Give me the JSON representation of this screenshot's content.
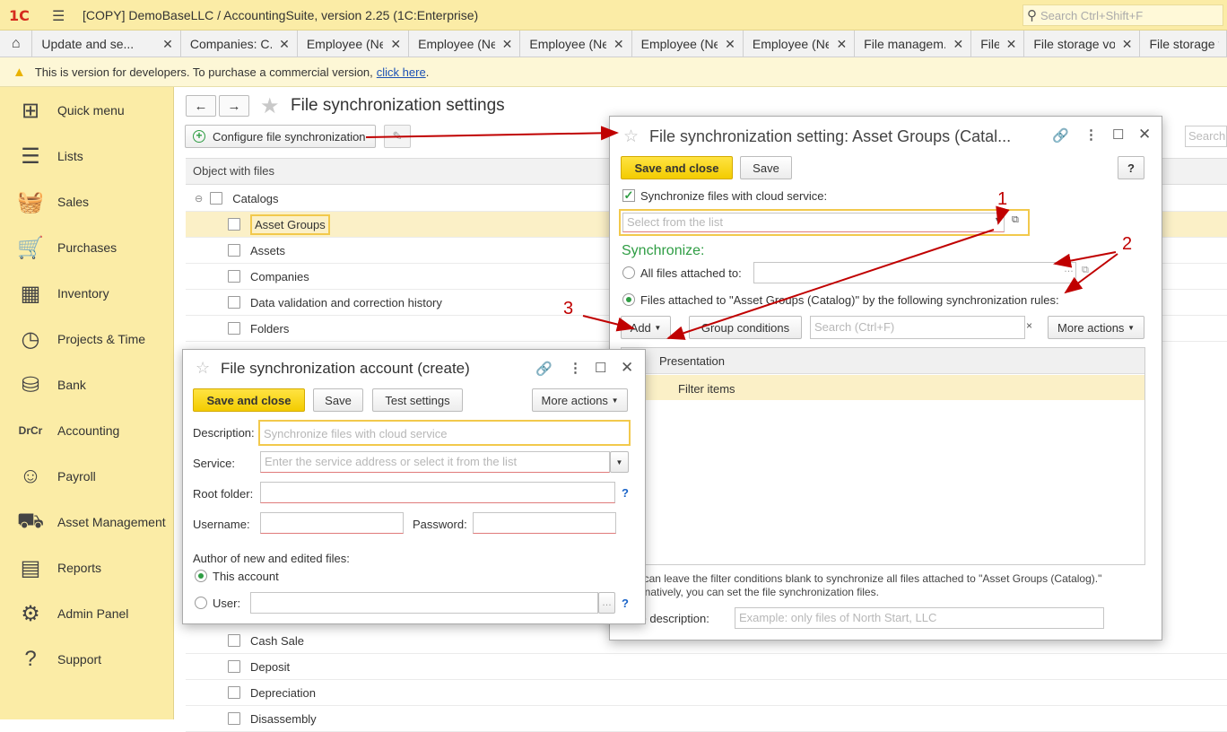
{
  "app": {
    "logo": "1С",
    "title": "[COPY] DemoBaseLLC / AccountingSuite, version 2.25  (1C:Enterprise)",
    "search_placeholder": "Search Ctrl+Shift+F"
  },
  "tabs": [
    {
      "label": "Update and se...",
      "w": 172
    },
    {
      "label": "Companies: C...",
      "w": 135
    },
    {
      "label": "Employee (New)",
      "w": 129
    },
    {
      "label": "Employee (New)",
      "w": 129
    },
    {
      "label": "Employee (New)",
      "w": 129
    },
    {
      "label": "Employee (New)",
      "w": 129
    },
    {
      "label": "Employee (New)",
      "w": 129
    },
    {
      "label": "File managem...",
      "w": 135
    },
    {
      "label": "Files",
      "w": 61
    },
    {
      "label": "File storage vol...",
      "w": 134
    },
    {
      "label": "File storage v",
      "w": 100
    }
  ],
  "banner": {
    "text": "This is version for developers. To purchase a commercial version,",
    "link": "click here",
    "end": "."
  },
  "sidebar": {
    "items": [
      {
        "label": "Quick menu",
        "icon": "⊞"
      },
      {
        "label": "Lists",
        "icon": "☰"
      },
      {
        "label": "Sales",
        "icon": "🧺"
      },
      {
        "label": "Purchases",
        "icon": "🛒"
      },
      {
        "label": "Inventory",
        "icon": "▦"
      },
      {
        "label": "Projects & Time",
        "icon": "◷"
      },
      {
        "label": "Bank",
        "icon": "⛁"
      },
      {
        "label": "Accounting",
        "icon": "DrCr"
      },
      {
        "label": "Payroll",
        "icon": "☺"
      },
      {
        "label": "Asset Management",
        "icon": "⛟"
      },
      {
        "label": "Reports",
        "icon": "▤"
      },
      {
        "label": "Admin Panel",
        "icon": "⚙"
      },
      {
        "label": "Support",
        "icon": "?"
      }
    ]
  },
  "main": {
    "title": "File synchronization settings",
    "configure_btn": "Configure file synchronization",
    "search_placeholder": "Search",
    "column_header": "Object with files",
    "rows_top": [
      {
        "label": "Catalogs",
        "group": true
      },
      {
        "label": "Asset Groups",
        "selected": true
      },
      {
        "label": "Assets"
      },
      {
        "label": "Companies"
      },
      {
        "label": "Data validation and correction history"
      },
      {
        "label": "Folders"
      }
    ],
    "rows_bottom": [
      {
        "label": "Cash Sale"
      },
      {
        "label": "Deposit"
      },
      {
        "label": "Depreciation"
      },
      {
        "label": "Disassembly"
      }
    ]
  },
  "setting_dialog": {
    "title": "File synchronization setting: Asset Groups (Catal...",
    "save_close": "Save and close",
    "save": "Save",
    "help": "?",
    "sync_checkbox": "Synchronize files with cloud service:",
    "account_placeholder": "Select from the list",
    "synchronize_heading": "Synchronize:",
    "all_files_label": "All files attached to:",
    "rules_label": "Files attached to \"Asset Groups (Catalog)\" by the following synchronization rules:",
    "add": "Add",
    "group_conditions": "Group conditions",
    "search_placeholder": "Search (Ctrl+F)",
    "more_actions": "More actions",
    "col_presentation": "Presentation",
    "filter_items": "Filter items",
    "hint_line1": "You can leave the filter conditions blank to synchronize all files attached to \"Asset Groups (Catalog).\"",
    "hint_line2": "Alternatively, you can set the file synchronization files.",
    "rule_desc_label": "Rule description:",
    "rule_desc_placeholder": "Example: only files of North Start, LLC"
  },
  "account_dialog": {
    "title": "File synchronization account (create)",
    "save_close": "Save and close",
    "save": "Save",
    "test": "Test settings",
    "more_actions": "More actions",
    "description_label": "Description:",
    "description_placeholder": "Synchronize files with cloud service",
    "service_label": "Service:",
    "service_placeholder": "Enter the service address or select it from the list",
    "root_label": "Root folder:",
    "username_label": "Username:",
    "password_label": "Password:",
    "author_heading": "Author of new and edited files:",
    "this_account": "This account",
    "user_label": "User:",
    "help": "?"
  },
  "annotations": {
    "n1": "1",
    "n2": "2",
    "n3": "3",
    "color": "#c00000"
  }
}
